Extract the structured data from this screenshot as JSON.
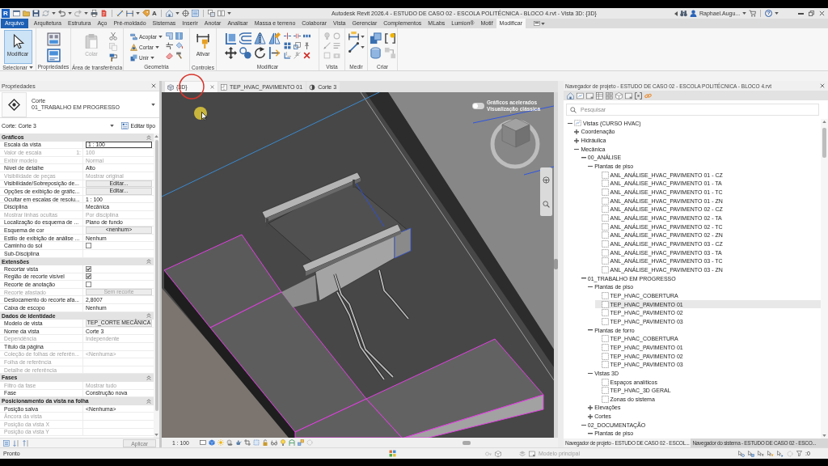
{
  "title_bar": {
    "logo": "R",
    "text_tool": "A",
    "title": "Autodesk Revit 2026.4 - ESTUDO DE CASO 02 - ESCOLA POLITÉCNICA - BLOCO 4.rvt - Vista 3D: {3D}",
    "user": "Raphael.Augu...",
    "help": "?"
  },
  "ribbon": {
    "tabs": [
      {
        "label": "Arquivo",
        "kind": "file",
        "selected": false
      },
      {
        "label": "Arquitetura",
        "kind": "tab",
        "selected": false
      },
      {
        "label": "Estrutura",
        "kind": "tab",
        "selected": false
      },
      {
        "label": "Aço",
        "kind": "tab",
        "selected": false
      },
      {
        "label": "Pré-moldado",
        "kind": "tab",
        "selected": false
      },
      {
        "label": "Sistemas",
        "kind": "tab",
        "selected": false
      },
      {
        "label": "Inserir",
        "kind": "tab",
        "selected": false
      },
      {
        "label": "Anotar",
        "kind": "tab",
        "selected": false
      },
      {
        "label": "Analisar",
        "kind": "tab",
        "selected": false
      },
      {
        "label": "Massa e terreno",
        "kind": "tab",
        "selected": false
      },
      {
        "label": "Colaborar",
        "kind": "tab",
        "selected": false
      },
      {
        "label": "Vista",
        "kind": "tab",
        "selected": false
      },
      {
        "label": "Gerenciar",
        "kind": "tab",
        "selected": false
      },
      {
        "label": "Complementos",
        "kind": "tab",
        "selected": false
      },
      {
        "label": "MLabs",
        "kind": "tab",
        "selected": false
      },
      {
        "label": "Lumion®",
        "kind": "tab",
        "selected": false
      },
      {
        "label": "Motif",
        "kind": "tab",
        "selected": false
      },
      {
        "label": "Modificar",
        "kind": "tab",
        "selected": true
      }
    ],
    "panels": [
      {
        "kind": "select",
        "label": "Selecionar",
        "dropdown": true,
        "tools": [
          {
            "label": "Modificar",
            "selected": true
          }
        ]
      },
      {
        "kind": "properties",
        "label": "Propriedades"
      },
      {
        "kind": "clipboard",
        "label": "Área de transferência",
        "tools": [
          {
            "label": "Colar",
            "disabled": true
          }
        ]
      },
      {
        "kind": "geometry",
        "label": "Geometria",
        "tools": [
          {
            "label": "Acoplar",
            "dropdown": true
          },
          {
            "label": "Cortar",
            "dropdown": true
          },
          {
            "label": "Unir",
            "dropdown": true
          }
        ]
      },
      {
        "kind": "controls",
        "label": "Controles",
        "tools": [
          {
            "label": "Ativar"
          }
        ]
      },
      {
        "kind": "modify",
        "label": "Modificar"
      },
      {
        "kind": "view",
        "label": "Vista"
      },
      {
        "kind": "measure",
        "label": "Medir"
      },
      {
        "kind": "create",
        "label": "Criar"
      }
    ]
  },
  "properties": {
    "title": "Propriedades",
    "type_selector": {
      "category": "Corte",
      "type": "01_TRABALHO EM PROGRESSO"
    },
    "instance": "Corte: Corte 3",
    "edit_type": "Editar tipo",
    "groups": [
      {
        "title": "Gráficos",
        "expanded": true,
        "rows": [
          {
            "label": "Escala da vista",
            "kind": "input",
            "value": "1 : 100",
            "disabled": false
          },
          {
            "label": "Valor de escala",
            "suffix": "1:",
            "kind": "text",
            "value": "100",
            "disabled": true
          },
          {
            "label": "Exibir modelo",
            "kind": "text",
            "value": "Normal",
            "disabled": true
          },
          {
            "label": "Nível de detalhe",
            "kind": "text",
            "value": "Alto",
            "disabled": false
          },
          {
            "label": "Visibilidade de peças",
            "kind": "text",
            "value": "Mostrar original",
            "disabled": true
          },
          {
            "label": "Visibilidade/Sobreposição de...",
            "kind": "button",
            "value": "Editar...",
            "disabled": false
          },
          {
            "label": "Opções de exibição de gráfic...",
            "kind": "button",
            "value": "Editar...",
            "disabled": false
          },
          {
            "label": "Ocultar em escalas de resolu...",
            "kind": "text",
            "value": "1 : 100",
            "disabled": false
          },
          {
            "label": "Disciplina",
            "kind": "text",
            "value": "Mecânica",
            "disabled": false
          },
          {
            "label": "Mostrar linhas ocultas",
            "kind": "text",
            "value": "Por disciplina",
            "disabled": true
          },
          {
            "label": "Localização do esquema de ...",
            "kind": "text",
            "value": "Plano de fundo",
            "disabled": false
          },
          {
            "label": "Esquema de cor",
            "kind": "button",
            "value": "<nenhum>",
            "disabled": false
          },
          {
            "label": "Estilo de exibição de análise ...",
            "kind": "text",
            "value": "Nenhum",
            "disabled": false
          },
          {
            "label": "Caminho do sol",
            "kind": "checkbox",
            "checked": false,
            "disabled": false
          },
          {
            "label": "Sub-Disciplina",
            "kind": "text",
            "disabled": false
          }
        ]
      },
      {
        "title": "Extensões",
        "expanded": true,
        "rows": [
          {
            "label": "Recortar vista",
            "kind": "checkbox",
            "checked": true,
            "disabled": false
          },
          {
            "label": "Região de recorte visível",
            "kind": "checkbox",
            "checked": true,
            "disabled": false
          },
          {
            "label": "Recorte de anotação",
            "kind": "checkbox",
            "checked": false,
            "disabled": false
          },
          {
            "label": "Recorte afastado",
            "kind": "button",
            "value": "Sem recorte",
            "disabled": true
          },
          {
            "label": "Deslocamento do recorte afa...",
            "kind": "text",
            "value": "2,8007",
            "disabled": false
          },
          {
            "label": "Caixa de escopo",
            "kind": "text",
            "value": "Nenhum",
            "disabled": false
          }
        ]
      },
      {
        "title": "Dados de identidade",
        "expanded": true,
        "rows": [
          {
            "label": "Modelo de vista",
            "kind": "button",
            "value": "TEP_CORTE MECÂNICA",
            "disabled": false
          },
          {
            "label": "Nome da vista",
            "kind": "text",
            "value": "Corte 3",
            "disabled": false
          },
          {
            "label": "Dependência",
            "kind": "text",
            "value": "Independente",
            "disabled": true
          },
          {
            "label": "Título da página",
            "kind": "text",
            "disabled": false
          },
          {
            "label": "Coleção de folhas de referên...",
            "kind": "text",
            "value": "<Nenhuma>",
            "disabled": true
          },
          {
            "label": "Folha de referência",
            "kind": "text",
            "disabled": true
          },
          {
            "label": "Detalhe de referência",
            "kind": "text",
            "disabled": true
          }
        ]
      },
      {
        "title": "Fases",
        "expanded": true,
        "rows": [
          {
            "label": "Filtro da fase",
            "kind": "text",
            "value": "Mostrar tudo",
            "disabled": true
          },
          {
            "label": "Fase",
            "kind": "text",
            "value": "Construção nova",
            "disabled": false
          }
        ]
      },
      {
        "title": "Posicionamento da vista na folha",
        "expanded": true,
        "rows": [
          {
            "label": "Posição salva",
            "kind": "text",
            "value": "<Nenhuma>",
            "disabled": false
          },
          {
            "label": "Âncora da vista",
            "kind": "text",
            "disabled": true
          },
          {
            "label": "Posição da vista X",
            "kind": "text",
            "disabled": true
          },
          {
            "label": "Posição da vista Y",
            "kind": "text",
            "disabled": true
          }
        ]
      }
    ],
    "apply": {
      "label": "Aplicar",
      "disabled": true
    }
  },
  "view": {
    "tabs": [
      {
        "label": "{3D}",
        "kind": "model",
        "selected": true
      },
      {
        "label": "TEP_HVAC_PAVIMENTO 01",
        "kind": "plan",
        "selected": false
      },
      {
        "label": "Corte 3",
        "kind": "section",
        "selected": false
      }
    ],
    "graphics_toggle": {
      "on": false,
      "label": "Gráficos acelerados",
      "sublabel": "Visualização clássica"
    },
    "scale": "1 : 100"
  },
  "project_browser": {
    "title": "Navegador de projeto - ESTUDO DE CASO 02 - ESCOLA POLITÉCNICA - BLOCO 4.rvt",
    "search": {
      "placeholder": "Pesquisar"
    },
    "tree": [
      {
        "label": "Vistas (CURSO HVAC)",
        "kind": "root",
        "expanded": true,
        "selected": false,
        "children": [
          {
            "label": "Coordenação",
            "kind": "folder",
            "expanded": false,
            "selected": false
          },
          {
            "label": "Hidráulica",
            "kind": "folder",
            "expanded": false,
            "selected": false
          },
          {
            "label": "Mecânica",
            "kind": "folder",
            "expanded": true,
            "selected": false,
            "children": [
              {
                "label": "00_ANÁLISE",
                "kind": "folder",
                "expanded": true,
                "selected": false,
                "children": [
                  {
                    "label": "Plantas de piso",
                    "kind": "folder",
                    "expanded": true,
                    "selected": false,
                    "children": [
                      {
                        "label": "ANL_ANÁLISE_HVAC_PAVIMENTO 01 - CZ",
                        "kind": "view",
                        "selected": false
                      },
                      {
                        "label": "ANL_ANÁLISE_HVAC_PAVIMENTO 01 - TA",
                        "kind": "view",
                        "selected": false
                      },
                      {
                        "label": "ANL_ANÁLISE_HVAC_PAVIMENTO 01 - TC",
                        "kind": "view",
                        "selected": false
                      },
                      {
                        "label": "ANL_ANÁLISE_HVAC_PAVIMENTO 01 - ZN",
                        "kind": "view",
                        "selected": false
                      },
                      {
                        "label": "ANL_ANÁLISE_HVAC_PAVIMENTO 02 - CZ",
                        "kind": "view",
                        "selected": false
                      },
                      {
                        "label": "ANL_ANÁLISE_HVAC_PAVIMENTO 02 - TA",
                        "kind": "view",
                        "selected": false
                      },
                      {
                        "label": "ANL_ANÁLISE_HVAC_PAVIMENTO 02 - TC",
                        "kind": "view",
                        "selected": false
                      },
                      {
                        "label": "ANL_ANÁLISE_HVAC_PAVIMENTO 02 - ZN",
                        "kind": "view",
                        "selected": false
                      },
                      {
                        "label": "ANL_ANÁLISE_HVAC_PAVIMENTO 03 - CZ",
                        "kind": "view",
                        "selected": false
                      },
                      {
                        "label": "ANL_ANÁLISE_HVAC_PAVIMENTO 03 - TA",
                        "kind": "view",
                        "selected": false
                      },
                      {
                        "label": "ANL_ANÁLISE_HVAC_PAVIMENTO 03 - TC",
                        "kind": "view",
                        "selected": false
                      },
                      {
                        "label": "ANL_ANÁLISE_HVAC_PAVIMENTO 03 - ZN",
                        "kind": "view",
                        "selected": false
                      }
                    ]
                  }
                ]
              },
              {
                "label": "01_TRABALHO EM PROGRESSO",
                "kind": "folder",
                "expanded": true,
                "selected": false,
                "children": [
                  {
                    "label": "Plantas de piso",
                    "kind": "folder",
                    "expanded": true,
                    "selected": false,
                    "children": [
                      {
                        "label": "TEP_HVAC_COBERTURA",
                        "kind": "view",
                        "selected": false
                      },
                      {
                        "label": "TEP_HVAC_PAVIMENTO 01",
                        "kind": "view",
                        "selected": true
                      },
                      {
                        "label": "TEP_HVAC_PAVIMENTO 02",
                        "kind": "view",
                        "selected": false
                      },
                      {
                        "label": "TEP_HVAC_PAVIMENTO 03",
                        "kind": "view",
                        "selected": false
                      }
                    ]
                  },
                  {
                    "label": "Plantas de forro",
                    "kind": "folder",
                    "expanded": true,
                    "selected": false,
                    "children": [
                      {
                        "label": "TEP_HVAC_COBERTURA",
                        "kind": "view",
                        "selected": false
                      },
                      {
                        "label": "TEP_HVAC_PAVIMENTO 01",
                        "kind": "view",
                        "selected": false
                      },
                      {
                        "label": "TEP_HVAC_PAVIMENTO 02",
                        "kind": "view",
                        "selected": false
                      },
                      {
                        "label": "TEP_HVAC_PAVIMENTO 03",
                        "kind": "view",
                        "selected": false
                      }
                    ]
                  },
                  {
                    "label": "Vistas 3D",
                    "kind": "folder",
                    "expanded": true,
                    "selected": false,
                    "children": [
                      {
                        "label": "Espaços analíticos",
                        "kind": "view",
                        "selected": false
                      },
                      {
                        "label": "TEP_HVAC_3D GERAL",
                        "kind": "view",
                        "selected": false
                      },
                      {
                        "label": "Zonas do sistema",
                        "kind": "view",
                        "selected": false
                      }
                    ]
                  },
                  {
                    "label": "Elevações",
                    "kind": "folder",
                    "expanded": false,
                    "selected": false
                  },
                  {
                    "label": "Cortes",
                    "kind": "folder",
                    "expanded": false,
                    "selected": false
                  }
                ]
              },
              {
                "label": "02_DOCUMENTAÇÃO",
                "kind": "folder",
                "expanded": true,
                "selected": false,
                "children": [
                  {
                    "label": "Plantas de piso",
                    "kind": "folder",
                    "expanded": true,
                    "selected": false
                  }
                ]
              }
            ]
          }
        ]
      }
    ],
    "tabs": [
      {
        "label": "Navegador de projeto - ESTUDO DE CASO 02 - ESCOL...",
        "selected": true
      },
      {
        "label": "Navegador do sistema - ESTUDO DE CASO 02 - ESCO...",
        "selected": false
      }
    ]
  },
  "status_bar": {
    "message": "Pronto",
    "model": {
      "label": "Modelo principal",
      "disabled": true
    },
    "filter_count": ":0"
  }
}
